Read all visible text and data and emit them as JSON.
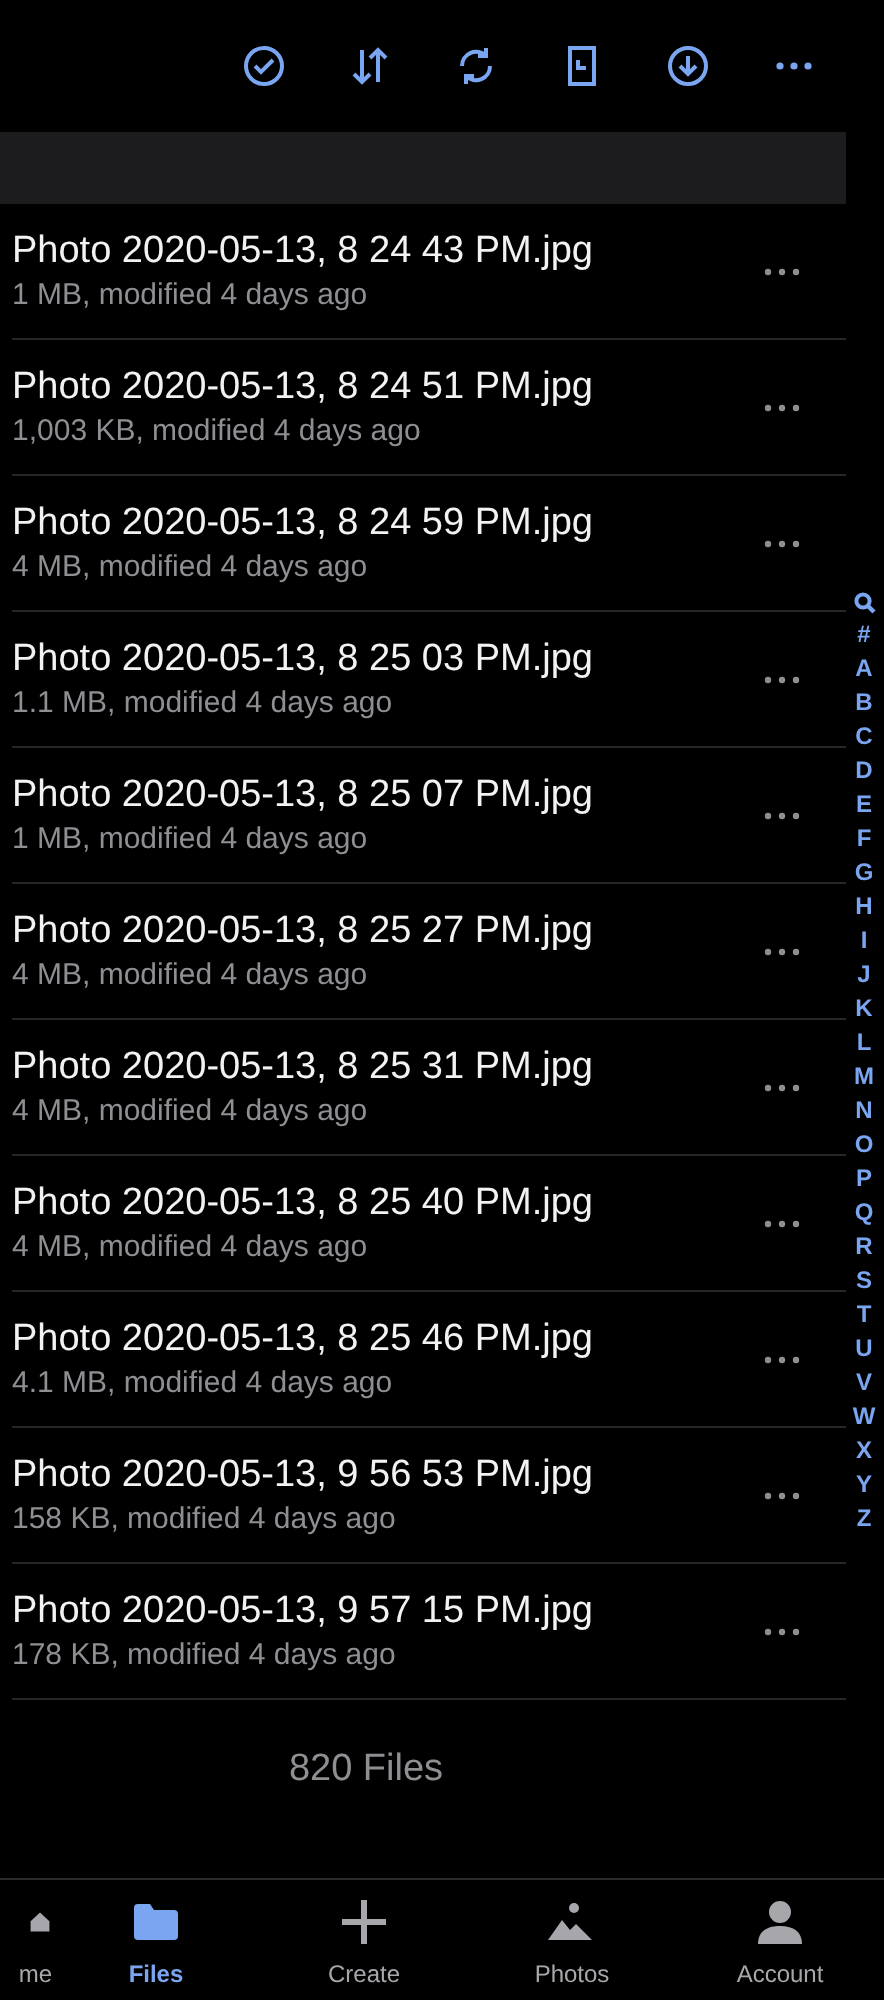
{
  "toolbar": {
    "buttons": [
      {
        "kind": "select"
      },
      {
        "kind": "sort"
      },
      {
        "kind": "sync"
      },
      {
        "kind": "recent"
      },
      {
        "kind": "download"
      },
      {
        "kind": "more"
      }
    ]
  },
  "files": [
    {
      "name": "Photo 2020-05-13, 8 24 43 PM.jpg",
      "details": "1 MB, modified 4 days ago"
    },
    {
      "name": "Photo 2020-05-13, 8 24 51 PM.jpg",
      "details": "1,003 KB, modified 4 days ago"
    },
    {
      "name": "Photo 2020-05-13, 8 24 59 PM.jpg",
      "details": "4 MB, modified 4 days ago"
    },
    {
      "name": "Photo 2020-05-13, 8 25 03 PM.jpg",
      "details": "1.1 MB, modified 4 days ago"
    },
    {
      "name": "Photo 2020-05-13, 8 25 07 PM.jpg",
      "details": "1 MB, modified 4 days ago"
    },
    {
      "name": "Photo 2020-05-13, 8 25 27 PM.jpg",
      "details": "4 MB, modified 4 days ago"
    },
    {
      "name": "Photo 2020-05-13, 8 25 31 PM.jpg",
      "details": "4 MB, modified 4 days ago"
    },
    {
      "name": "Photo 2020-05-13, 8 25 40 PM.jpg",
      "details": "4 MB, modified 4 days ago"
    },
    {
      "name": "Photo 2020-05-13, 8 25 46 PM.jpg",
      "details": "4.1 MB, modified 4 days ago"
    },
    {
      "name": "Photo 2020-05-13, 9 56 53 PM.jpg",
      "details": "158 KB, modified 4 days ago"
    },
    {
      "name": "Photo 2020-05-13, 9 57 15 PM.jpg",
      "details": "178 KB, modified 4 days ago"
    }
  ],
  "file_count": "820 Files",
  "index_bar": [
    "#",
    "A",
    "B",
    "C",
    "D",
    "E",
    "F",
    "G",
    "H",
    "I",
    "J",
    "K",
    "L",
    "M",
    "N",
    "O",
    "P",
    "Q",
    "R",
    "S",
    "T",
    "U",
    "V",
    "W",
    "X",
    "Y",
    "Z"
  ],
  "tab_bar": [
    {
      "kind": "home",
      "label": "me",
      "selected": false
    },
    {
      "kind": "files",
      "label": "Files",
      "selected": true
    },
    {
      "kind": "create",
      "label": "Create",
      "selected": false
    },
    {
      "kind": "photos",
      "label": "Photos",
      "selected": false
    },
    {
      "kind": "account",
      "label": "Account",
      "selected": false
    }
  ]
}
